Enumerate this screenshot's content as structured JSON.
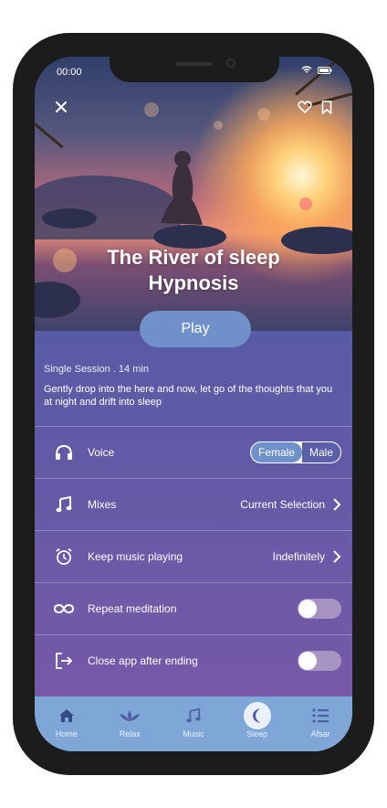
{
  "status": {
    "time": "00:00"
  },
  "session": {
    "title_line1": "The River of sleep",
    "title_line2": "Hypnosis",
    "play_label": "Play",
    "meta": "Single Session . 14 min",
    "description": "Gently drop into the here and now, let go of the thoughts that you at night and drift into sleep"
  },
  "settings": {
    "voice": {
      "label": "Voice",
      "options": [
        "Female",
        "Male"
      ],
      "selected": "Female"
    },
    "mixes": {
      "label": "Mixes",
      "value": "Current Selection"
    },
    "keep_music": {
      "label": "Keep music playing",
      "value": "Indefinitely"
    },
    "repeat": {
      "label": "Repeat meditation",
      "on": false
    },
    "close_app": {
      "label": "Close app after ending",
      "on": false
    }
  },
  "tabs": [
    {
      "label": "Home",
      "icon": "home-icon"
    },
    {
      "label": "Relax",
      "icon": "lotus-icon"
    },
    {
      "label": "Music",
      "icon": "music-note-icon"
    },
    {
      "label": "Sleep",
      "icon": "moon-icon",
      "active": true
    },
    {
      "label": "Afsar",
      "icon": "list-icon"
    }
  ],
  "colors": {
    "accent": "#6f90c9",
    "tabbar": "#7ea7d8"
  }
}
